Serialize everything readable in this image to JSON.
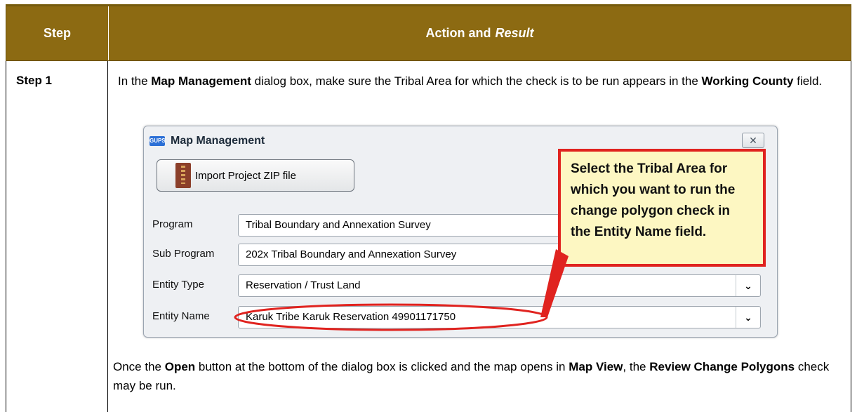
{
  "table": {
    "header": {
      "step": "Step",
      "action": "Action and",
      "result": "Result"
    },
    "row": {
      "step": "Step 1",
      "text1": "In the ",
      "b1": "Map Management",
      "text2": " dialog box, make sure the Tribal Area for which the check is to be run appears in the ",
      "b2": "Working County",
      "text3": " field."
    },
    "bottom": {
      "t1": "Once the ",
      "b1": "Open",
      "t2": " button at the bottom of the dialog box is clicked and the map opens in ",
      "b2": "Map View",
      "t3": ", the ",
      "b3": "Review Change Polygons",
      "t4": " check may be run."
    }
  },
  "dialog": {
    "title": "Map Management",
    "app_icon": "GUPS",
    "close_icon": "close-icon",
    "import_button": "Import Project ZIP file",
    "fields": [
      {
        "label": "Program",
        "value": "Tribal Boundary and Annexation Survey"
      },
      {
        "label": "Sub Program",
        "value": "202x Tribal Boundary and Annexation Survey"
      },
      {
        "label": "Entity Type",
        "value": "Reservation / Trust Land"
      },
      {
        "label": "Entity Name",
        "value": "Karuk Tribe Karuk Reservation 49901171750"
      }
    ]
  },
  "callout": {
    "text": "Select the Tribal Area for which you want to run the change polygon check in the Entity Name field."
  },
  "colors": {
    "header": "#8c6a12",
    "callout_border": "#e0231f",
    "callout_fill": "#fdf7c2"
  }
}
